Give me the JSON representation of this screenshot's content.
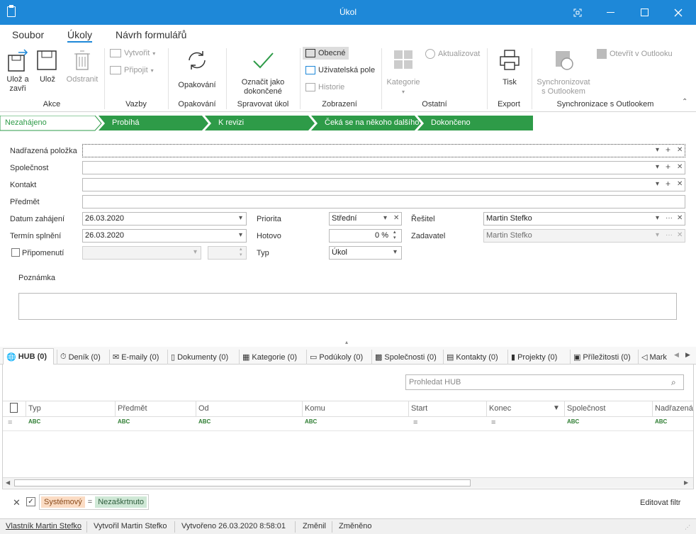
{
  "window": {
    "title": "Úkol"
  },
  "ribbon_tabs": [
    "Soubor",
    "Úkoly",
    "Návrh formulářů"
  ],
  "ribbon": {
    "save_close": "Ulož a zavři",
    "save": "Ulož",
    "delete": "Odstranit",
    "group_actions": "Akce",
    "create": "Vytvořit",
    "attach": "Připojit",
    "group_links": "Vazby",
    "repeat": "Opakování",
    "group_repeat": "Opakování",
    "mark_done": "Označit jako dokončené",
    "group_manage": "Spravovat úkol",
    "general": "Obecné",
    "user_fields": "Uživatelská pole",
    "history": "Historie",
    "group_view": "Zobrazení",
    "category": "Kategorie",
    "update": "Aktualizovat",
    "group_other": "Ostatní",
    "print": "Tisk",
    "group_export": "Export",
    "sync_outlook": "Synchronizovat s Outlookem",
    "open_outlook": "Otevřít v Outlooku",
    "group_sync": "Synchronizace s Outlookem"
  },
  "steps": [
    "Nezahájeno",
    "Probíhá",
    "K revizi",
    "Čeká se na někoho dalšího",
    "Dokončeno"
  ],
  "colors": {
    "accent": "#1e88d8",
    "step_green": "#2e9b48"
  },
  "form": {
    "parent_label": "Nadřazená položka",
    "company_label": "Společnost",
    "contact_label": "Kontakt",
    "subject_label": "Předmět",
    "start_label": "Datum zahájení",
    "start_value": "26.03.2020",
    "due_label": "Termín splnění",
    "due_value": "26.03.2020",
    "remind_label": "Připomenutí",
    "priority_label": "Priorita",
    "priority_value": "Střední",
    "done_label": "Hotovo",
    "done_value": "0 %",
    "type_label": "Typ",
    "type_value": "Úkol",
    "solver_label": "Řešitel",
    "solver_value": "Martin Stefko",
    "requester_label": "Zadavatel",
    "requester_value": "Martin Stefko",
    "note_label": "Poznámka"
  },
  "bottom_tabs": [
    "HUB (0)",
    "Deník (0)",
    "E-maily (0)",
    "Dokumenty (0)",
    "Kategorie (0)",
    "Podúkoly (0)",
    "Společnosti (0)",
    "Kontakty (0)",
    "Projekty (0)",
    "Příležitosti (0)",
    "Mark"
  ],
  "hub": {
    "search_placeholder": "Prohledat HUB",
    "columns": [
      "Typ",
      "Předmět",
      "Od",
      "Komu",
      "Start",
      "Konec",
      "Společnost",
      "Nadřazená"
    ],
    "filter_abc": "ABC"
  },
  "filter_bar": {
    "chip1": "Systémový",
    "eq": "=",
    "chip2": "Nezaškrtnuto",
    "edit": "Editovat filtr"
  },
  "status": {
    "owner": "Vlastník Martin Stefko",
    "created_by": "Vytvořil Martin Stefko",
    "created": "Vytvořeno 26.03.2020 8:58:01",
    "changed": "Změnil",
    "modified": "Změněno"
  }
}
